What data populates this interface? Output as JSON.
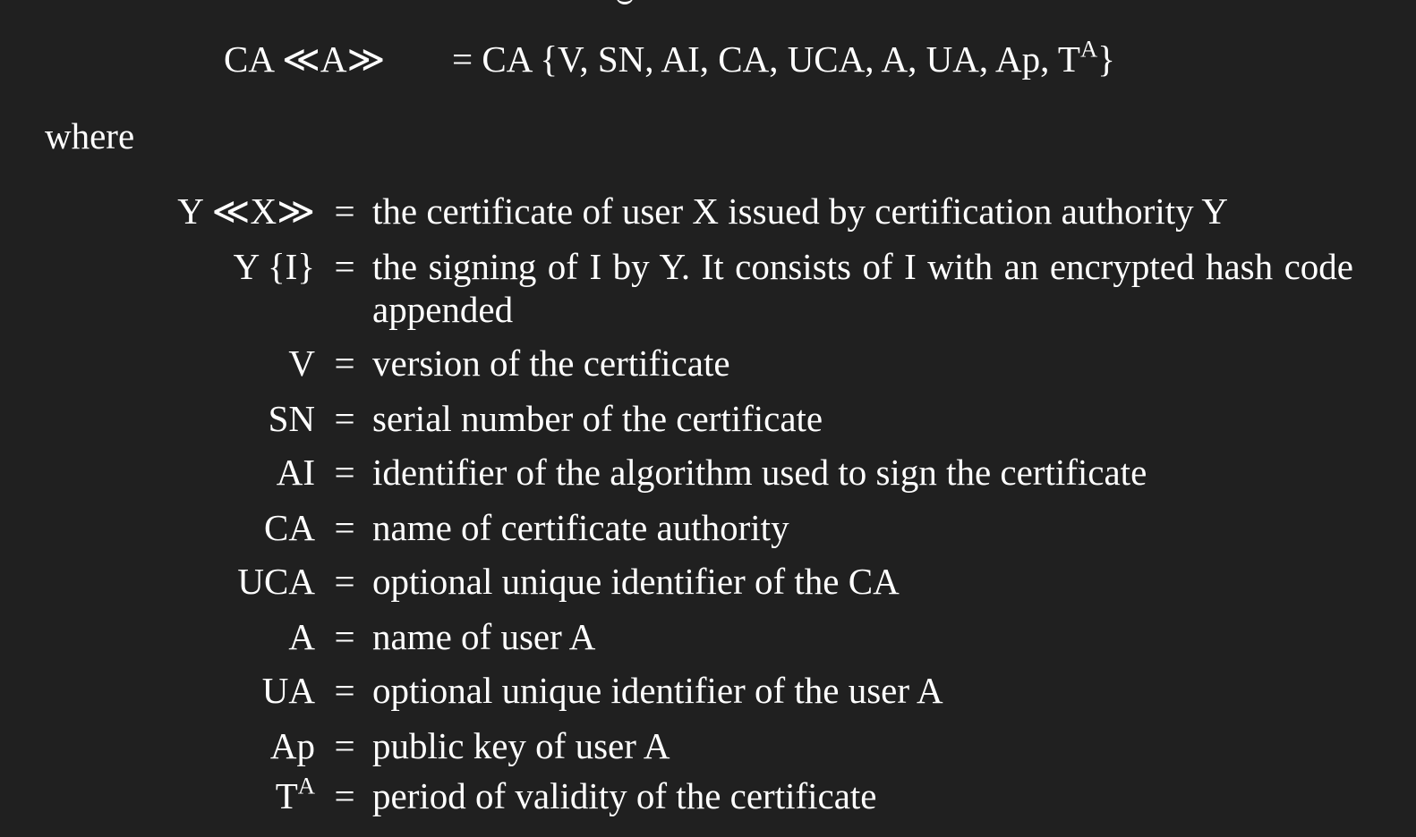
{
  "formula": {
    "lhs": "CA ≪A≫",
    "eq": "=",
    "rhs": "CA {V, SN, AI, CA, UCA, A, UA, Ap, T",
    "rhs_sup": "A",
    "rhs_close": "}"
  },
  "where_label": "where",
  "definitions": [
    {
      "symbol": "Y ≪X≫",
      "sup": "",
      "eq": "=",
      "text": "the certificate of user X issued by certification authority Y"
    },
    {
      "symbol": "Y {I}",
      "sup": "",
      "eq": "=",
      "text": "the signing of I by Y. It consists of I with an encrypted hash code appended"
    },
    {
      "symbol": "V",
      "sup": "",
      "eq": "=",
      "text": "version of the certificate"
    },
    {
      "symbol": "SN",
      "sup": "",
      "eq": "=",
      "text": "serial number of the certificate"
    },
    {
      "symbol": "AI",
      "sup": "",
      "eq": "=",
      "text": "identifier of the algorithm used to sign the certificate"
    },
    {
      "symbol": "CA",
      "sup": "",
      "eq": "=",
      "text": "name of certificate authority"
    },
    {
      "symbol": "UCA",
      "sup": "",
      "eq": "=",
      "text": "optional unique identifier of the CA"
    },
    {
      "symbol": "A",
      "sup": "",
      "eq": "=",
      "text": "name of user A"
    },
    {
      "symbol": "UA",
      "sup": "",
      "eq": "=",
      "text": "optional unique identifier of the user A"
    },
    {
      "symbol": "Ap",
      "sup": "",
      "eq": "=",
      "text": "public key of user A"
    },
    {
      "symbol": "T",
      "sup": "A",
      "eq": "=",
      "text": "period of validity of the certificate"
    }
  ]
}
